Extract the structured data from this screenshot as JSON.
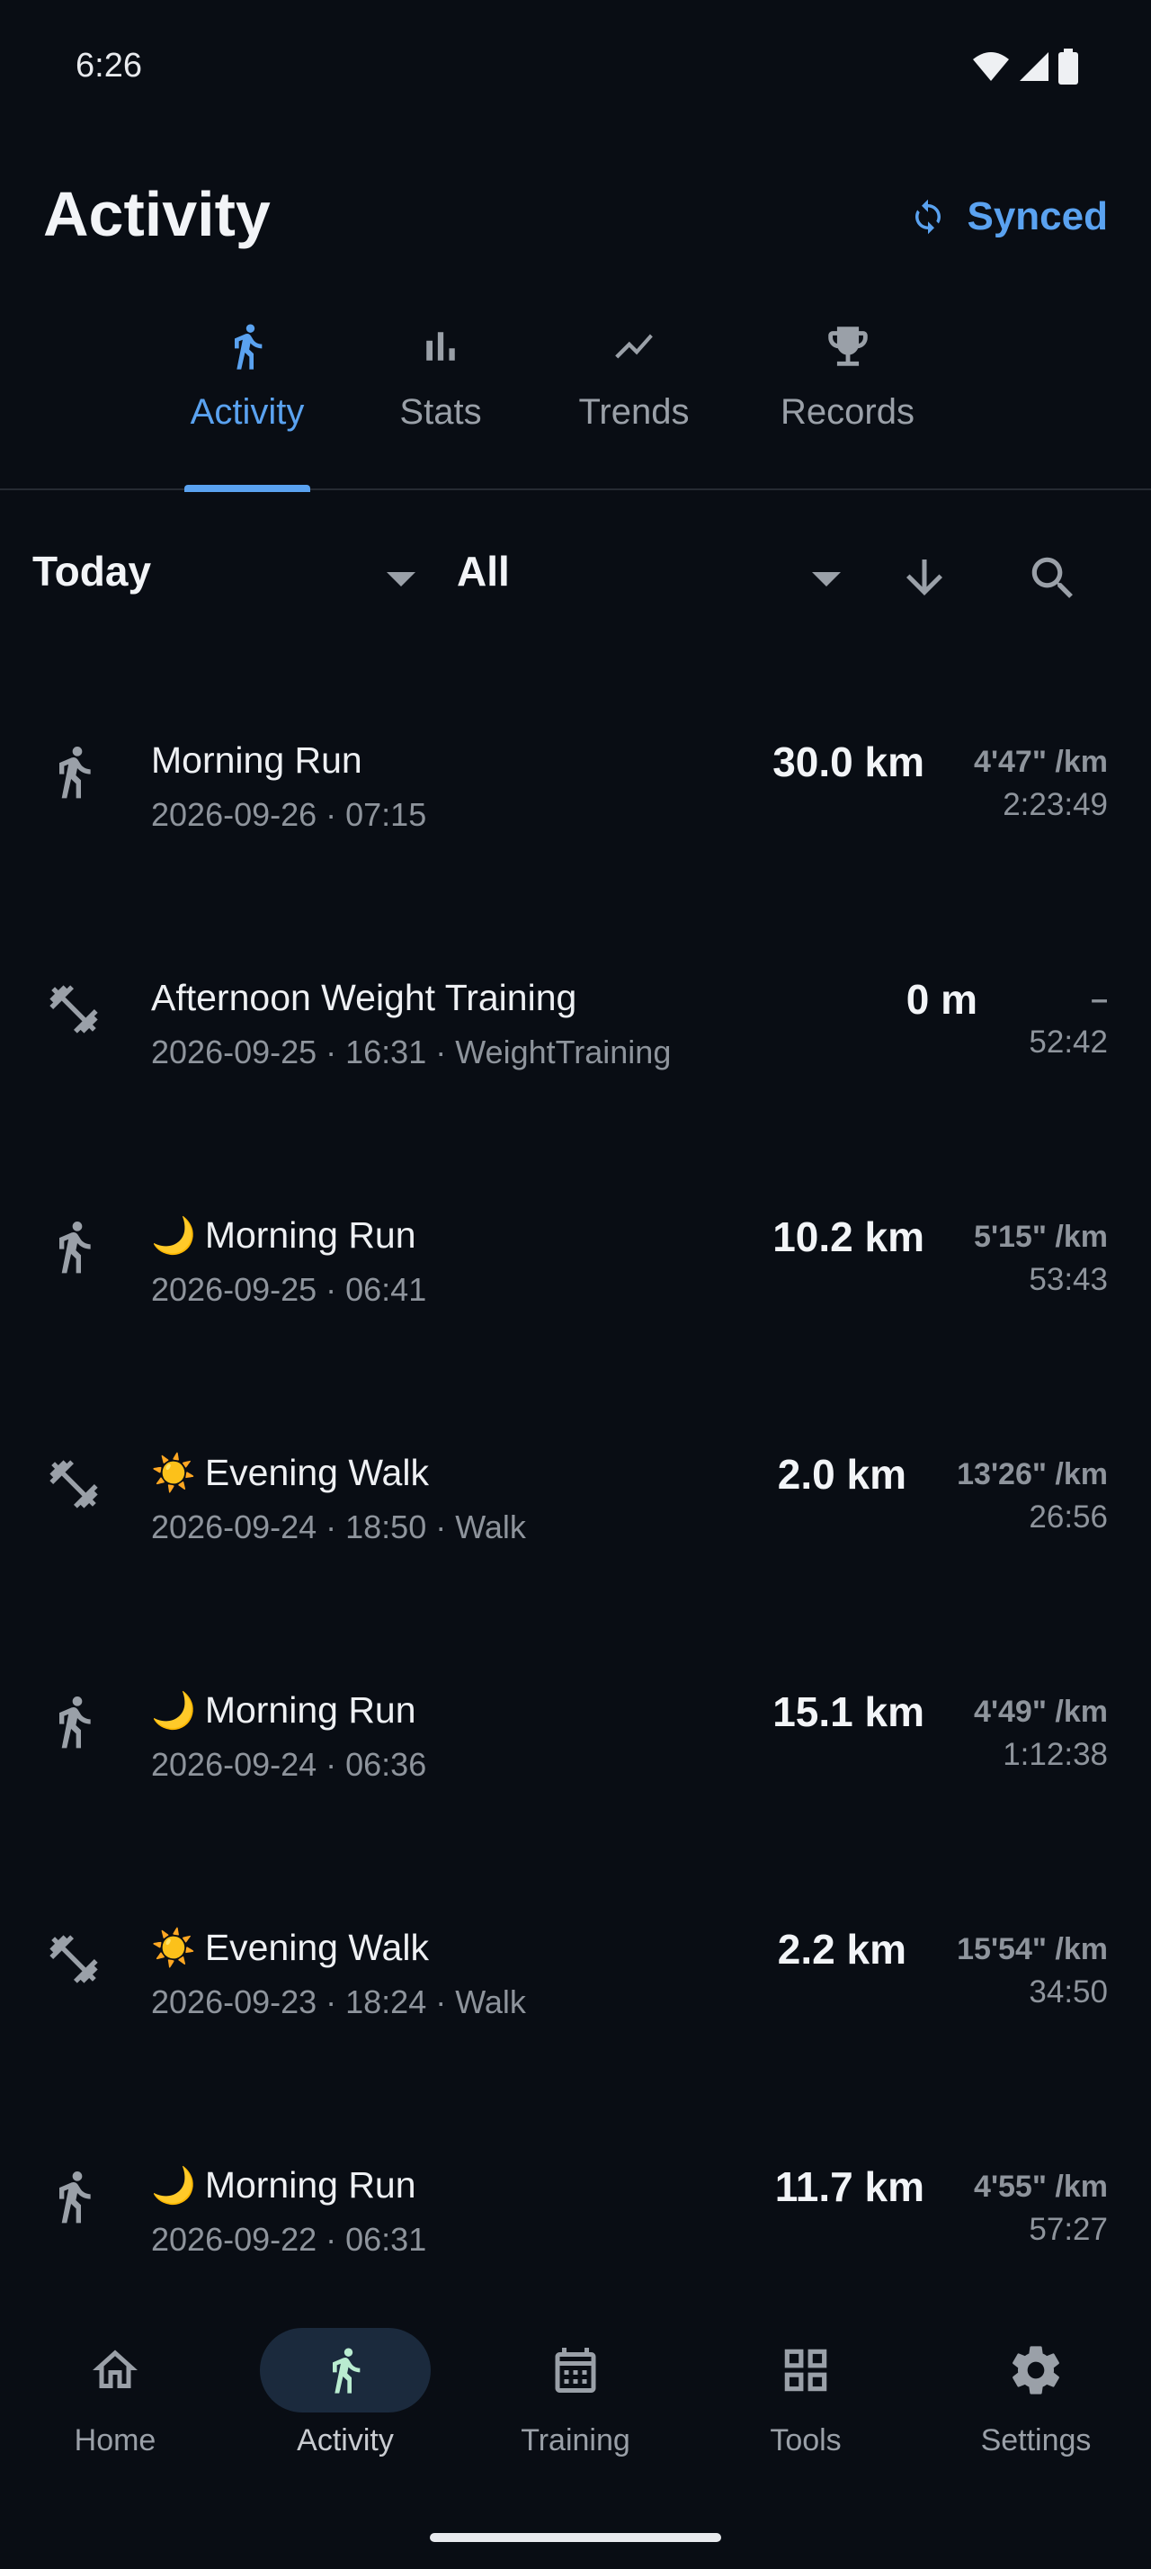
{
  "status_bar": {
    "time": "6:26"
  },
  "header": {
    "title": "Activity",
    "sync_label": "Synced",
    "accent_color": "#5aa2f0"
  },
  "tabs": [
    {
      "label": "Activity",
      "icon": "run-icon",
      "active": true
    },
    {
      "label": "Stats",
      "icon": "bar-chart-icon",
      "active": false
    },
    {
      "label": "Trends",
      "icon": "trend-line-icon",
      "active": false
    },
    {
      "label": "Records",
      "icon": "trophy-icon",
      "active": false
    }
  ],
  "filters": {
    "period": "Today",
    "type": "All"
  },
  "activities": [
    {
      "icon": "run-icon",
      "emoji": "",
      "name": "Morning Run",
      "meta": "2026-09-26 · 07:15",
      "distance": "30.0 km",
      "pace": "4'47\" /km",
      "duration": "2:23:49"
    },
    {
      "icon": "dumbbell-icon",
      "emoji": "",
      "name": "Afternoon Weight Training",
      "meta": "2026-09-25 · 16:31 · WeightTraining",
      "distance": "0 m",
      "pace": "–",
      "duration": "52:42"
    },
    {
      "icon": "run-icon",
      "emoji": "🌙",
      "name": "Morning Run",
      "meta": "2026-09-25 · 06:41",
      "distance": "10.2 km",
      "pace": "5'15\" /km",
      "duration": "53:43"
    },
    {
      "icon": "dumbbell-icon",
      "emoji": "☀️",
      "name": "Evening Walk",
      "meta": "2026-09-24 · 18:50 · Walk",
      "distance": "2.0 km",
      "pace": "13'26\" /km",
      "duration": "26:56"
    },
    {
      "icon": "run-icon",
      "emoji": "🌙",
      "name": "Morning Run",
      "meta": "2026-09-24 · 06:36",
      "distance": "15.1 km",
      "pace": "4'49\" /km",
      "duration": "1:12:38"
    },
    {
      "icon": "dumbbell-icon",
      "emoji": "☀️",
      "name": "Evening Walk",
      "meta": "2026-09-23 · 18:24 · Walk",
      "distance": "2.2 km",
      "pace": "15'54\" /km",
      "duration": "34:50"
    },
    {
      "icon": "run-icon",
      "emoji": "🌙",
      "name": "Morning Run",
      "meta": "2026-09-22 · 06:31",
      "distance": "11.7 km",
      "pace": "4'55\" /km",
      "duration": "57:27"
    }
  ],
  "bottom_nav": [
    {
      "label": "Home",
      "icon": "home-icon",
      "active": false
    },
    {
      "label": "Activity",
      "icon": "run-icon",
      "active": true
    },
    {
      "label": "Training",
      "icon": "calendar-icon",
      "active": false
    },
    {
      "label": "Tools",
      "icon": "grid-icon",
      "active": false
    },
    {
      "label": "Settings",
      "icon": "gear-icon",
      "active": false
    }
  ]
}
